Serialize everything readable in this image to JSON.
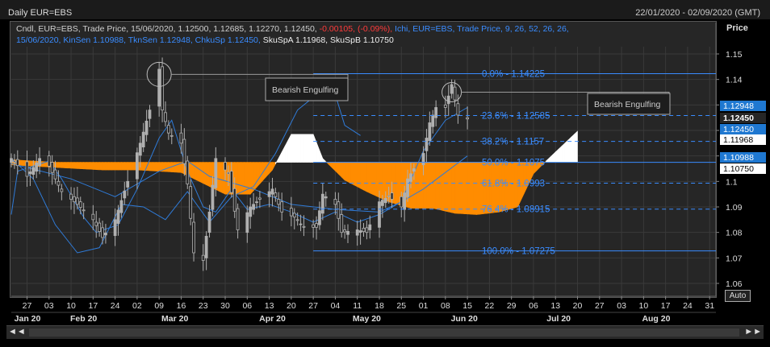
{
  "header": {
    "title": "Daily EUR=EBS",
    "date_range": "22/01/2020 - 02/09/2020 (GMT)"
  },
  "legend": {
    "line1_a": "Cndl, EUR=EBS, Trade Price,  15/06/2020, 1.12500, 1.12685, 1.12270, 1.12450, ",
    "line1_neg": "-0.00105, (-0.09%),",
    "line1_b": " Ichi, EUR=EBS, Trade Price,  9, 26, 52, 26, 26,",
    "line2_blue": "15/06/2020, KinSen 1.10988, TknSen 1.12948, ChkuSp 1.12450,",
    "line2_white": " SkuSpA 1.11968, SkuSpB 1.10750"
  },
  "y_axis_title": "Price",
  "auto_button": "Auto",
  "scroll": {
    "left": "◄◄",
    "right": "►►"
  },
  "colors": {
    "cloud_bearish": "#ff8c00",
    "cloud_bullish": "#ffffff",
    "lines": "#2f7bd8",
    "fib": "#3a8cff",
    "candles": "#b0b0b0",
    "background": "#262626"
  },
  "chart_data": {
    "type": "candlestick",
    "title": "Daily EUR=EBS",
    "ylabel": "Price",
    "ylim": [
      1.055,
      1.16
    ],
    "y_ticks": [
      "1.15",
      "1.14",
      "1.13",
      "1.12",
      "1.11",
      "1.1",
      "1.09",
      "1.08",
      "1.07",
      "1.06"
    ],
    "x_ticks": [
      {
        "d": "2020-01-27",
        "label": "27"
      },
      {
        "d": "2020-02-03",
        "label": "03"
      },
      {
        "d": "2020-02-10",
        "label": "10"
      },
      {
        "d": "2020-02-17",
        "label": "17"
      },
      {
        "d": "2020-02-24",
        "label": "24"
      },
      {
        "d": "2020-03-02",
        "label": "02"
      },
      {
        "d": "2020-03-09",
        "label": "09"
      },
      {
        "d": "2020-03-16",
        "label": "16"
      },
      {
        "d": "2020-03-23",
        "label": "23"
      },
      {
        "d": "2020-03-30",
        "label": "30"
      },
      {
        "d": "2020-04-06",
        "label": "06"
      },
      {
        "d": "2020-04-13",
        "label": "13"
      },
      {
        "d": "2020-04-20",
        "label": "20"
      },
      {
        "d": "2020-04-27",
        "label": "27"
      },
      {
        "d": "2020-05-04",
        "label": "04"
      },
      {
        "d": "2020-05-11",
        "label": "11"
      },
      {
        "d": "2020-05-18",
        "label": "18"
      },
      {
        "d": "2020-05-25",
        "label": "25"
      },
      {
        "d": "2020-06-01",
        "label": "01"
      },
      {
        "d": "2020-06-08",
        "label": "08"
      },
      {
        "d": "2020-06-15",
        "label": "15"
      },
      {
        "d": "2020-06-22",
        "label": "22"
      },
      {
        "d": "2020-06-29",
        "label": "29"
      },
      {
        "d": "2020-07-06",
        "label": "06"
      },
      {
        "d": "2020-07-13",
        "label": "13"
      },
      {
        "d": "2020-07-20",
        "label": "20"
      },
      {
        "d": "2020-07-27",
        "label": "27"
      },
      {
        "d": "2020-08-03",
        "label": "03"
      },
      {
        "d": "2020-08-10",
        "label": "10"
      },
      {
        "d": "2020-08-17",
        "label": "17"
      },
      {
        "d": "2020-08-24",
        "label": "24"
      },
      {
        "d": "2020-08-31",
        "label": "31"
      }
    ],
    "month_labels": [
      {
        "d": "2020-01-22",
        "label": "Jan 20"
      },
      {
        "d": "2020-02-14",
        "label": "Feb 20"
      },
      {
        "d": "2020-03-14",
        "label": "Mar 20"
      },
      {
        "d": "2020-04-14",
        "label": "Apr 20"
      },
      {
        "d": "2020-05-14",
        "label": "May 20"
      },
      {
        "d": "2020-06-14",
        "label": "Jun 20"
      },
      {
        "d": "2020-07-14",
        "label": "Jul 20"
      },
      {
        "d": "2020-08-14",
        "label": "Aug 20"
      }
    ],
    "x_start": "2020-01-22",
    "x_end": "2020-09-02",
    "close_series": [
      [
        "2020-01-22",
        1.109
      ],
      [
        "2020-01-27",
        1.102
      ],
      [
        "2020-01-31",
        1.109
      ],
      [
        "2020-02-03",
        1.106
      ],
      [
        "2020-02-07",
        1.096
      ],
      [
        "2020-02-12",
        1.091
      ],
      [
        "2020-02-17",
        1.085
      ],
      [
        "2020-02-20",
        1.078
      ],
      [
        "2020-02-24",
        1.085
      ],
      [
        "2020-02-28",
        1.1
      ],
      [
        "2020-03-03",
        1.115
      ],
      [
        "2020-03-06",
        1.128
      ],
      [
        "2020-03-09",
        1.144
      ],
      [
        "2020-03-10",
        1.128
      ],
      [
        "2020-03-12",
        1.119
      ],
      [
        "2020-03-16",
        1.115
      ],
      [
        "2020-03-18",
        1.099
      ],
      [
        "2020-03-20",
        1.072
      ],
      [
        "2020-03-23",
        1.069
      ],
      [
        "2020-03-25",
        1.088
      ],
      [
        "2020-03-27",
        1.109
      ],
      [
        "2020-03-31",
        1.103
      ],
      [
        "2020-04-03",
        1.081
      ],
      [
        "2020-04-07",
        1.09
      ],
      [
        "2020-04-10",
        1.093
      ],
      [
        "2020-04-14",
        1.097
      ],
      [
        "2020-04-17",
        1.088
      ],
      [
        "2020-04-21",
        1.086
      ],
      [
        "2020-04-24",
        1.082
      ],
      [
        "2020-04-28",
        1.082
      ],
      [
        "2020-04-30",
        1.095
      ],
      [
        "2020-05-04",
        1.091
      ],
      [
        "2020-05-06",
        1.08
      ],
      [
        "2020-05-11",
        1.081
      ],
      [
        "2020-05-14",
        1.08
      ],
      [
        "2020-05-18",
        1.092
      ],
      [
        "2020-05-21",
        1.094
      ],
      [
        "2020-05-25",
        1.09
      ],
      [
        "2020-05-27",
        1.101
      ],
      [
        "2020-06-01",
        1.111
      ],
      [
        "2020-06-03",
        1.123
      ],
      [
        "2020-06-05",
        1.129
      ],
      [
        "2020-06-08",
        1.129
      ],
      [
        "2020-06-10",
        1.138
      ],
      [
        "2020-06-12",
        1.126
      ],
      [
        "2020-06-15",
        1.1245
      ]
    ],
    "ohlc_2020_06_15": {
      "open": 1.125,
      "high": 1.12685,
      "low": 1.1227,
      "close": 1.1245,
      "change": -0.00105,
      "change_pct": -0.09
    },
    "ichimoku": {
      "params": [
        9,
        26,
        52,
        26,
        26
      ],
      "kijun_sen": 1.10988,
      "tenkan_sen": 1.12948,
      "chikou_span": 1.1245,
      "senkou_span_a": 1.11968,
      "senkou_span_b": 1.1075,
      "tenkan_series": [
        [
          "2020-01-22",
          1.087
        ],
        [
          "2020-01-24",
          1.104
        ],
        [
          "2020-02-03",
          1.108
        ],
        [
          "2020-02-07",
          1.101
        ],
        [
          "2020-02-14",
          1.086
        ],
        [
          "2020-02-18",
          1.08
        ],
        [
          "2020-02-25",
          1.083
        ],
        [
          "2020-03-02",
          1.097
        ],
        [
          "2020-03-09",
          1.117
        ],
        [
          "2020-03-13",
          1.124
        ],
        [
          "2020-03-18",
          1.104
        ],
        [
          "2020-03-23",
          1.09
        ],
        [
          "2020-03-27",
          1.088
        ],
        [
          "2020-04-01",
          1.097
        ],
        [
          "2020-04-06",
          1.089
        ],
        [
          "2020-04-13",
          1.091
        ],
        [
          "2020-04-20",
          1.088
        ],
        [
          "2020-04-27",
          1.084
        ],
        [
          "2020-05-04",
          1.088
        ],
        [
          "2020-05-11",
          1.084
        ],
        [
          "2020-05-18",
          1.087
        ],
        [
          "2020-05-25",
          1.092
        ],
        [
          "2020-06-01",
          1.112
        ],
        [
          "2020-06-08",
          1.124
        ],
        [
          "2020-06-15",
          1.129
        ]
      ],
      "kijun_series": [
        [
          "2020-01-22",
          1.107
        ],
        [
          "2020-02-10",
          1.101
        ],
        [
          "2020-02-24",
          1.094
        ],
        [
          "2020-03-09",
          1.104
        ],
        [
          "2020-03-18",
          1.108
        ],
        [
          "2020-03-25",
          1.102
        ],
        [
          "2020-04-08",
          1.097
        ],
        [
          "2020-04-20",
          1.091
        ],
        [
          "2020-05-04",
          1.089
        ],
        [
          "2020-05-18",
          1.088
        ],
        [
          "2020-05-25",
          1.092
        ],
        [
          "2020-06-01",
          1.097
        ],
        [
          "2020-06-15",
          1.11
        ]
      ],
      "chikou_series": [
        [
          "2020-01-22",
          1.109
        ],
        [
          "2020-01-29",
          1.101
        ],
        [
          "2020-02-05",
          1.083
        ],
        [
          "2020-02-12",
          1.072
        ],
        [
          "2020-02-19",
          1.074
        ],
        [
          "2020-02-26",
          1.091
        ],
        [
          "2020-03-04",
          1.09
        ],
        [
          "2020-03-11",
          1.085
        ],
        [
          "2020-03-18",
          1.096
        ],
        [
          "2020-03-25",
          1.084
        ],
        [
          "2020-04-01",
          1.094
        ],
        [
          "2020-04-08",
          1.098
        ],
        [
          "2020-04-15",
          1.111
        ],
        [
          "2020-04-22",
          1.128
        ],
        [
          "2020-04-28",
          1.134
        ],
        [
          "2020-05-01",
          1.14
        ],
        [
          "2020-05-04",
          1.134
        ],
        [
          "2020-05-07",
          1.122
        ],
        [
          "2020-05-12",
          1.118
        ]
      ],
      "span_a_series": [
        [
          "2020-01-22",
          1.1065
        ],
        [
          "2020-02-05",
          1.1055
        ],
        [
          "2020-02-20",
          1.1045
        ],
        [
          "2020-03-02",
          1.1045
        ],
        [
          "2020-03-16",
          1.1035
        ],
        [
          "2020-03-30",
          1.095
        ],
        [
          "2020-04-07",
          1.095
        ],
        [
          "2020-04-14",
          1.1045
        ],
        [
          "2020-04-20",
          1.1185
        ],
        [
          "2020-04-27",
          1.1185
        ],
        [
          "2020-04-30",
          1.109
        ],
        [
          "2020-05-07",
          1.1005
        ],
        [
          "2020-05-14",
          1.096
        ],
        [
          "2020-05-21",
          1.092
        ],
        [
          "2020-05-28",
          1.0895
        ],
        [
          "2020-06-04",
          1.0895
        ],
        [
          "2020-06-11",
          1.0875
        ],
        [
          "2020-06-18",
          1.087
        ],
        [
          "2020-06-25",
          1.088
        ],
        [
          "2020-07-01",
          1.09
        ],
        [
          "2020-07-06",
          1.103
        ],
        [
          "2020-07-10",
          1.108
        ],
        [
          "2020-07-20",
          1.1197
        ]
      ],
      "span_b_series": [
        [
          "2020-01-22",
          1.1085
        ],
        [
          "2020-02-05",
          1.1075
        ],
        [
          "2020-02-20",
          1.1075
        ],
        [
          "2020-03-02",
          1.1075
        ],
        [
          "2020-03-16",
          1.1075
        ],
        [
          "2020-03-30",
          1.1075
        ],
        [
          "2020-04-07",
          1.1075
        ],
        [
          "2020-04-14",
          1.1075
        ],
        [
          "2020-04-20",
          1.1075
        ],
        [
          "2020-04-27",
          1.1075
        ],
        [
          "2020-04-30",
          1.1075
        ],
        [
          "2020-05-07",
          1.1075
        ],
        [
          "2020-05-14",
          1.1075
        ],
        [
          "2020-05-21",
          1.1075
        ],
        [
          "2020-05-28",
          1.1075
        ],
        [
          "2020-06-04",
          1.1075
        ],
        [
          "2020-06-11",
          1.1075
        ],
        [
          "2020-06-18",
          1.1075
        ],
        [
          "2020-06-25",
          1.1075
        ],
        [
          "2020-07-01",
          1.1075
        ],
        [
          "2020-07-06",
          1.1075
        ],
        [
          "2020-07-10",
          1.1075
        ],
        [
          "2020-07-20",
          1.1075
        ]
      ]
    },
    "fib_levels": [
      {
        "label": "0.0%",
        "value": "1.14225",
        "y": 1.14225,
        "style": "solid"
      },
      {
        "label": "23.6%",
        "value": "1.12585",
        "y": 1.12585,
        "style": "dashed"
      },
      {
        "label": "38.2%",
        "value": "1.1157",
        "y": 1.1157,
        "style": "dashed"
      },
      {
        "label": "50.0%",
        "value": "1.1075",
        "y": 1.1075,
        "style": "solid"
      },
      {
        "label": "61.8%",
        "value": "1.0993",
        "y": 1.0993,
        "style": "dashed"
      },
      {
        "label": "76.4%",
        "value": "1.08915",
        "y": 1.08915,
        "style": "dashed"
      },
      {
        "label": "100.0%",
        "value": "1.07275",
        "y": 1.07275,
        "style": "solid"
      }
    ],
    "fib_start": "2020-04-27",
    "annotations": [
      {
        "text": "Bearish Engulfing",
        "circle_date": "2020-03-09",
        "circle_y": 1.142
      },
      {
        "text": "Bearish Engulfing",
        "circle_date": "2020-06-10",
        "circle_y": 1.135
      }
    ],
    "price_tags": [
      {
        "value": "1.12948",
        "style": "blue"
      },
      {
        "value": "1.12450",
        "style": "current"
      },
      {
        "value": "1.12450",
        "style": "blue"
      },
      {
        "value": "1.11968",
        "style": "white"
      },
      {
        "value": "1.10988",
        "style": "blue"
      },
      {
        "value": "1.10750",
        "style": "white"
      }
    ]
  }
}
